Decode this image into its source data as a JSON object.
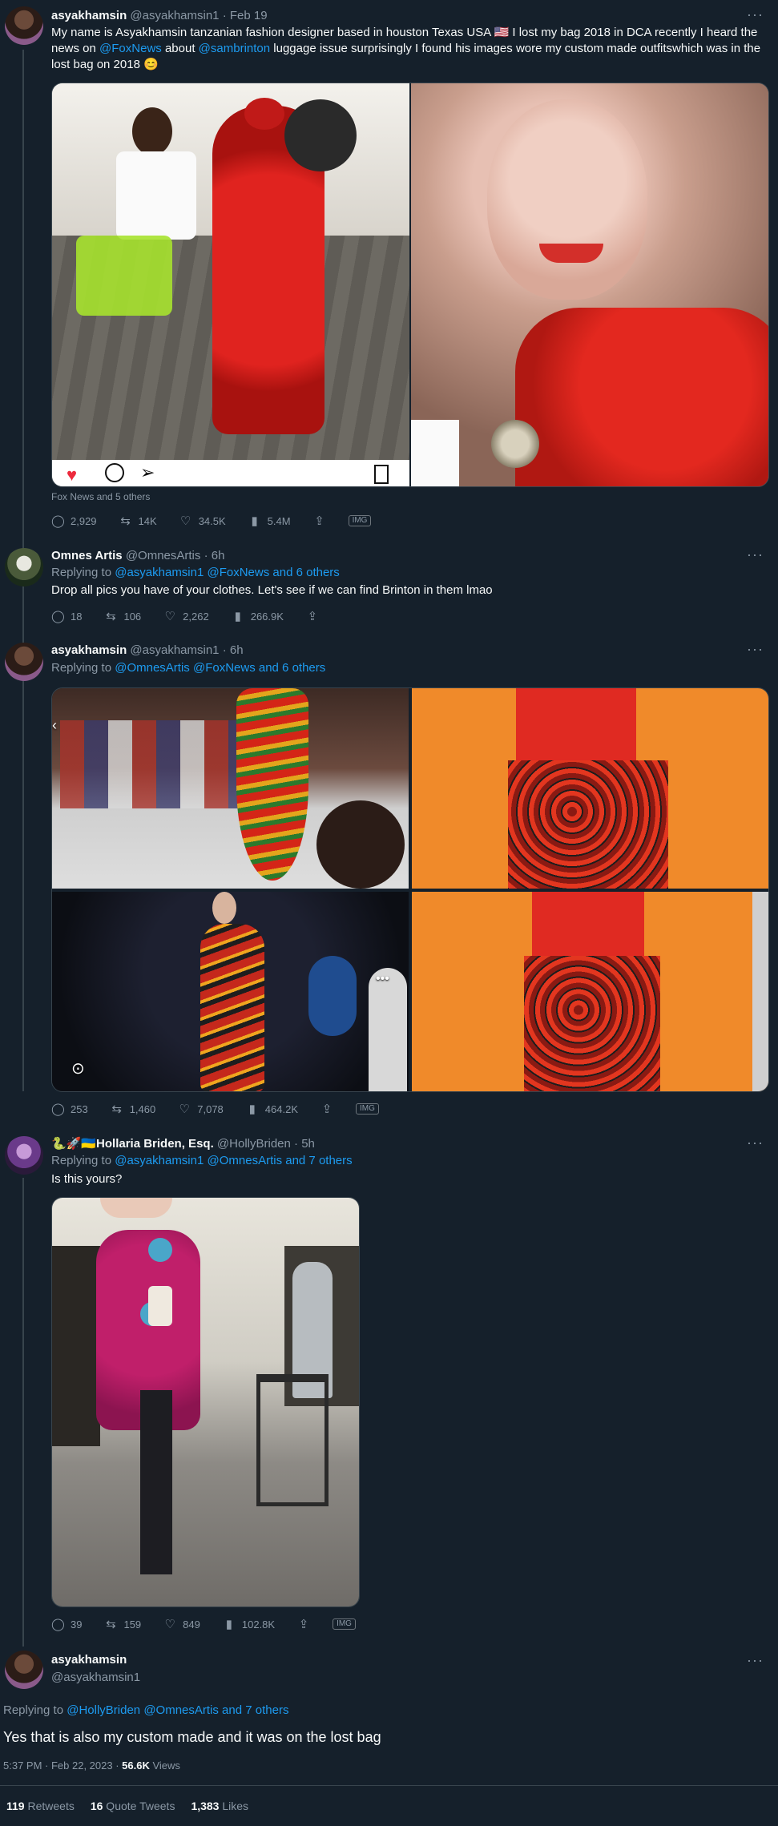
{
  "tweets": [
    {
      "name": "asyakhamsin",
      "handle": "@asyakhamsin1",
      "time": "· Feb 19",
      "text_a": "My name is Asyakhamsin tanzanian fashion designer  based in houston Texas USA 🇺🇸 I lost my bag 2018 in DCA  recently I heard the news on ",
      "mention1": "@FoxNews",
      "text_b": "  about ",
      "mention2": "@sambrinton",
      "text_c": " luggage issue surprisingly I found his images wore my custom made outfitswhich  was in the lost bag on 2018 😊",
      "media_caption": "Fox News and 5 others",
      "stats": {
        "replies": "2,929",
        "retweets": "14K",
        "likes": "34.5K",
        "views": "5.4M"
      },
      "badge": "IMG"
    },
    {
      "name": "Omnes Artis",
      "handle": "@OmnesArtis",
      "time": "· 6h",
      "reply_label": "Replying to ",
      "reply_targets": "@asyakhamsin1 @FoxNews and 6 others",
      "text": "Drop all pics you have of your clothes. Let's see if we can find Brinton in them lmao",
      "stats": {
        "replies": "18",
        "retweets": "106",
        "likes": "2,262",
        "views": "266.9K"
      }
    },
    {
      "name": "asyakhamsin",
      "handle": "@asyakhamsin1",
      "time": "· 6h",
      "reply_label": "Replying to ",
      "reply_targets": "@OmnesArtis @FoxNews and 6 others",
      "stats": {
        "replies": "253",
        "retweets": "1,460",
        "likes": "7,078",
        "views": "464.2K"
      },
      "badge": "IMG"
    },
    {
      "name_emoji": "🐍🚀🇺🇦",
      "name": "Hollaria Briden, Esq.",
      "handle": "@HollyBriden",
      "time": "· 5h",
      "reply_label": "Replying to ",
      "reply_targets": "@asyakhamsin1 @OmnesArtis and 7 others",
      "text": "Is this yours?",
      "stats": {
        "replies": "39",
        "retweets": "159",
        "likes": "849",
        "views": "102.8K"
      },
      "badge": "IMG"
    }
  ],
  "main_tweet": {
    "name": "asyakhamsin",
    "handle": "@asyakhamsin1",
    "reply_label": "Replying to ",
    "reply_targets": "@HollyBriden @OmnesArtis and 7 others",
    "text": "Yes that is also my custom made and it was on the lost bag",
    "timestamp": "5:37 PM · Feb 22, 2023 · ",
    "views_count": "56.6K",
    "views_label": " Views",
    "retweets_count": "119",
    "retweets_label": " Retweets",
    "quotes_count": "16",
    "quotes_label": " Quote Tweets",
    "likes_count": "1,383",
    "likes_label": " Likes"
  },
  "icons": [
    "reply-icon",
    "retweet-icon",
    "like-icon",
    "views-icon",
    "share-icon",
    "more-icon"
  ],
  "colors": {
    "background": "#15202b",
    "accent": "#1d9bf0",
    "muted": "#8b98a5",
    "border": "#38444d"
  }
}
